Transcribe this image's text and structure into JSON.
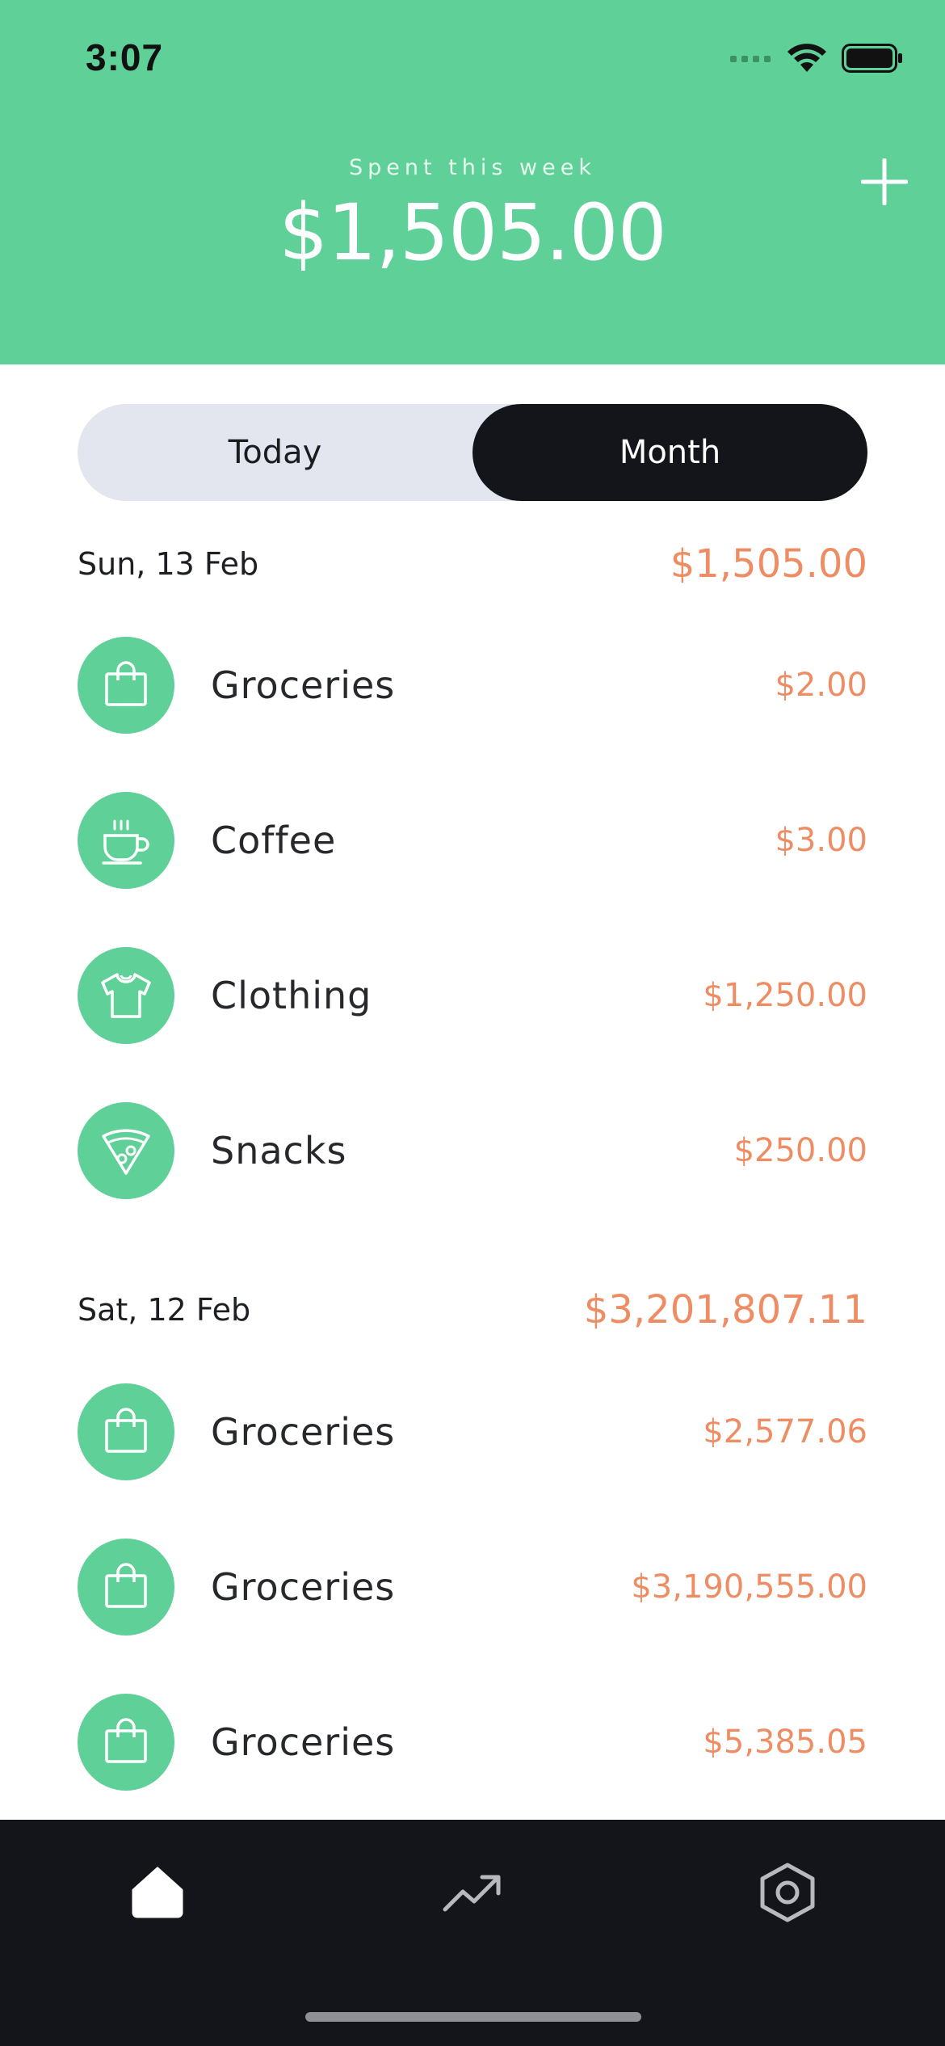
{
  "status_bar": {
    "time": "3:07"
  },
  "header": {
    "label": "Spent this week",
    "amount": "$1,505.00"
  },
  "segment": {
    "tabs": [
      "Today",
      "Month"
    ],
    "selected": "Month"
  },
  "days": [
    {
      "date": "Sun, 13 Feb",
      "total": "$1,505.00",
      "items": [
        {
          "name": "Groceries",
          "amount": "$2.00",
          "icon": "shopping-bag-icon"
        },
        {
          "name": "Coffee",
          "amount": "$3.00",
          "icon": "coffee-cup-icon"
        },
        {
          "name": "Clothing",
          "amount": "$1,250.00",
          "icon": "tshirt-icon"
        },
        {
          "name": "Snacks",
          "amount": "$250.00",
          "icon": "pizza-icon"
        }
      ]
    },
    {
      "date": "Sat, 12 Feb",
      "total": "$3,201,807.11",
      "items": [
        {
          "name": "Groceries",
          "amount": "$2,577.06",
          "icon": "shopping-bag-icon"
        },
        {
          "name": "Groceries",
          "amount": "$3,190,555.00",
          "icon": "shopping-bag-icon"
        },
        {
          "name": "Groceries",
          "amount": "$5,385.05",
          "icon": "shopping-bag-icon"
        }
      ]
    }
  ],
  "tabbar": {
    "items": [
      {
        "icon": "home-icon",
        "active": true
      },
      {
        "icon": "trending-up-icon",
        "active": false
      },
      {
        "icon": "settings-hexagon-icon",
        "active": false
      }
    ]
  },
  "colors": {
    "brand_green": "#5fd098",
    "accent_orange": "#ee8d63",
    "dark": "#13151a",
    "segment_bg": "#e3e6ef"
  }
}
